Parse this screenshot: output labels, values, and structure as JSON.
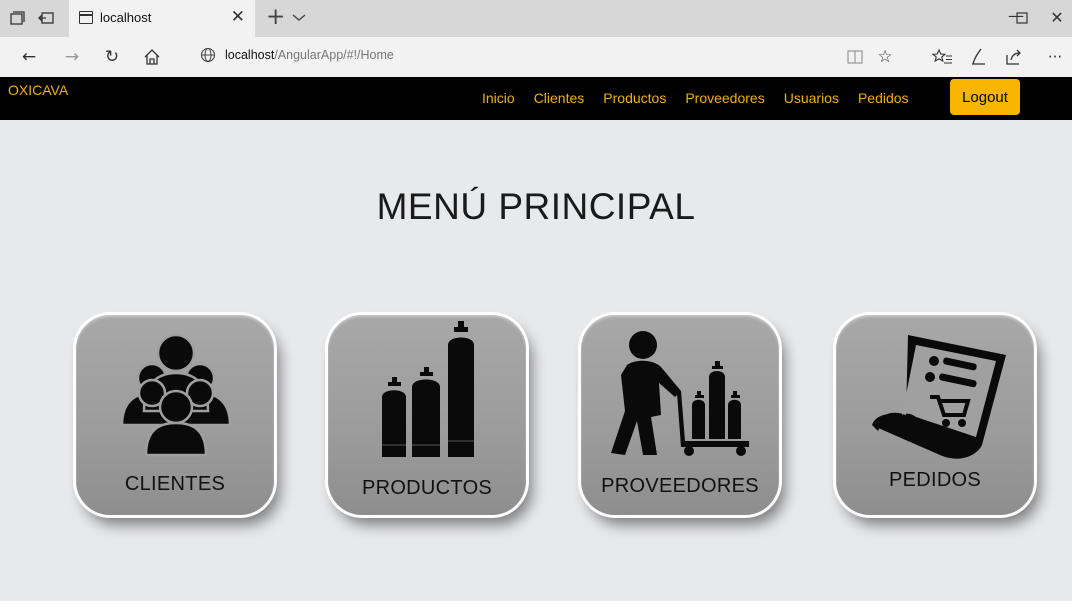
{
  "browser": {
    "tab_title": "localhost",
    "url_host": "localhost",
    "url_path": "/AngularApp/#!/Home",
    "icons": [
      "tab-set-aside-icon",
      "tab-back-icon",
      "page-icon",
      "close-icon",
      "plus-icon",
      "chevron-down-icon",
      "minimize-icon",
      "maximize-icon",
      "window-close-icon",
      "back-arrow-icon",
      "forward-arrow-icon",
      "refresh-icon",
      "home-icon",
      "globe-icon",
      "reading-view-icon",
      "star-icon",
      "favorites-icon",
      "pen-icon",
      "share-icon",
      "more-icon"
    ]
  },
  "navbar": {
    "brand": "OXICAVA",
    "links": [
      "Inicio",
      "Clientes",
      "Productos",
      "Proveedores",
      "Usuarios",
      "Pedidos"
    ],
    "logout": "Logout",
    "colors": {
      "background": "#000000",
      "link": "#f2b000",
      "logout_bg": "#f7b500"
    }
  },
  "main": {
    "title": "MENÚ PRINCIPAL",
    "tiles": [
      {
        "label": "CLIENTES",
        "icon": "group-people-icon"
      },
      {
        "label": "PRODUCTOS",
        "icon": "gas-cylinders-icon"
      },
      {
        "label": "PROVEEDORES",
        "icon": "worker-cylinder-cart-icon"
      },
      {
        "label": "PEDIDOS",
        "icon": "order-document-cart-icon"
      }
    ]
  }
}
